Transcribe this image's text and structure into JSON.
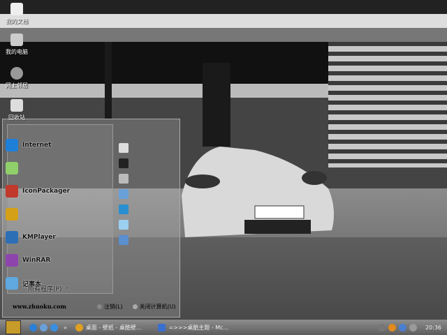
{
  "desktop": {
    "icons": [
      {
        "label": "我的文档",
        "icon": "my-documents-icon",
        "color": "#eeeeee"
      },
      {
        "label": "我的电脑",
        "icon": "my-computer-icon",
        "color": "#cccccc"
      },
      {
        "label": "网上邻居",
        "icon": "network-globe-icon",
        "color": "#999999"
      },
      {
        "label": "回收站",
        "icon": "recycle-bin-icon",
        "color": "#dddddd"
      }
    ]
  },
  "start_menu": {
    "items": [
      {
        "label": "Internet",
        "icon": "internet-explorer-icon",
        "color": "#1e7fd8"
      },
      {
        "label": "",
        "icon": "app-icon",
        "color": "#8fd06a"
      },
      {
        "label": "IconPackager",
        "icon": "iconpackager-icon",
        "color": "#c0392b"
      },
      {
        "label": "",
        "icon": "paint-icon",
        "color": "#d4a017"
      },
      {
        "label": "KMPlayer",
        "icon": "kmplayer-icon",
        "color": "#2c6fb5"
      },
      {
        "label": "WinRAR",
        "icon": "winrar-icon",
        "color": "#8e44ad"
      },
      {
        "label": "记事本",
        "icon": "notepad-icon",
        "color": "#5fa8e0"
      }
    ],
    "right_icons": [
      "documents-icon",
      "computer-icon",
      "network-icon",
      "control-panel-icon",
      "connect-icon",
      "help-icon",
      "run-icon"
    ],
    "all_programs": "所有程序(P)",
    "website": "www.zhuoku.com",
    "logoff": "注销(L)",
    "shutdown": "关闭计算机(U)"
  },
  "taskbar": {
    "tasks": [
      {
        "label": "桌面 - 壁纸 - 桌酷壁...",
        "icon": "chrome-icon"
      },
      {
        "label": "=>>>桌酷主题 - Mc...",
        "icon": "document-icon"
      }
    ],
    "overflow": "»",
    "clock": "20:36"
  }
}
